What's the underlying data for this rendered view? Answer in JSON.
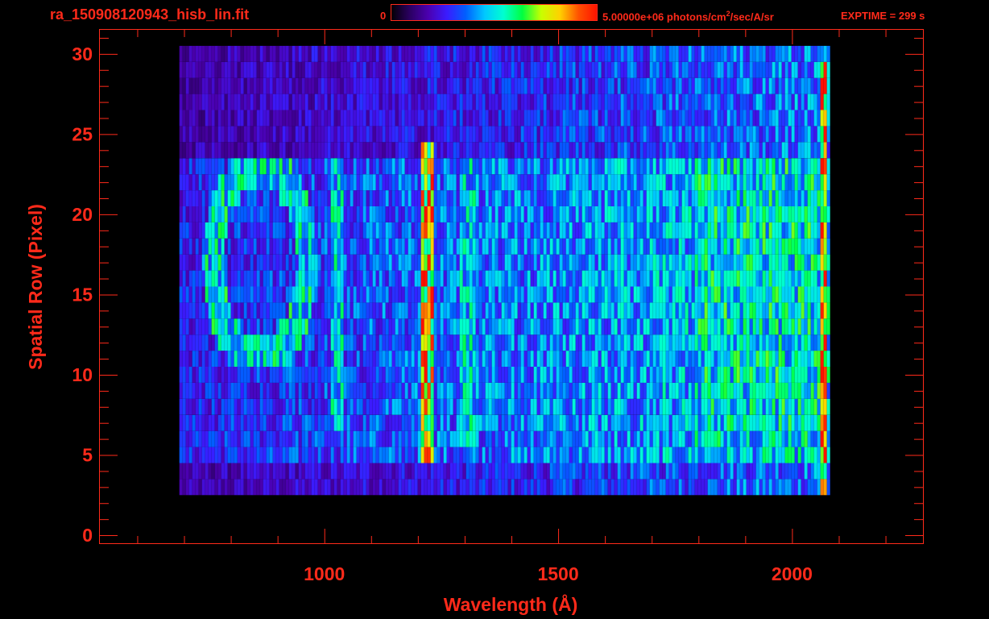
{
  "header": {
    "filename": "ra_150908120943_hisb_lin.fit",
    "colorbar_min": "0",
    "colorbar_max_prefix": "5.00000e+06 photons/cm",
    "colorbar_max_sup": "2",
    "colorbar_max_suffix": "/sec/A/sr",
    "exptime": "EXPTIME = 299 s"
  },
  "colors": {
    "axis": "#ff2a1a",
    "background": "#000000",
    "colormap": [
      "#000000",
      "#2a0060",
      "#4b00b0",
      "#3a1cff",
      "#0060ff",
      "#00c8ff",
      "#00ffd0",
      "#00ff40",
      "#c8ff00",
      "#ffd000",
      "#ff5000",
      "#ff1000"
    ]
  },
  "chart_data": {
    "type": "heatmap",
    "title": "ra_150908120943_hisb_lin.fit",
    "xlabel": "Wavelength (Å)",
    "ylabel": "Spatial Row (Pixel)",
    "xlim": [
      520,
      2280
    ],
    "ylim": [
      -0.5,
      31.5
    ],
    "xticks": [
      1000,
      1500,
      2000
    ],
    "yticks": [
      0,
      5,
      10,
      15,
      20,
      25,
      30
    ],
    "x_minor_step": 100,
    "y_minor_step": 1,
    "colorbar_range": [
      0,
      5000000
    ],
    "colorbar_units": "photons/cm^2/sec/A/sr",
    "data_extent": {
      "x": [
        690,
        2070
      ],
      "rows": [
        3,
        30
      ]
    },
    "bright_band_rows": [
      5,
      23
    ],
    "features": [
      {
        "label": "ring",
        "x_center": 860,
        "x_halfwidth": 100,
        "rows": [
          11,
          23
        ]
      },
      {
        "label": "line",
        "x": 1025,
        "rows": [
          7,
          23
        ]
      },
      {
        "label": "line",
        "x": 1216,
        "rows": [
          5,
          24
        ]
      },
      {
        "label": "line",
        "x": 1304,
        "rows": [
          6,
          23
        ]
      },
      {
        "label": "band",
        "x": [
          1790,
          2060
        ],
        "rows": [
          6,
          23
        ]
      },
      {
        "label": "edge",
        "x": 2065,
        "rows": [
          1,
          29
        ]
      }
    ]
  }
}
